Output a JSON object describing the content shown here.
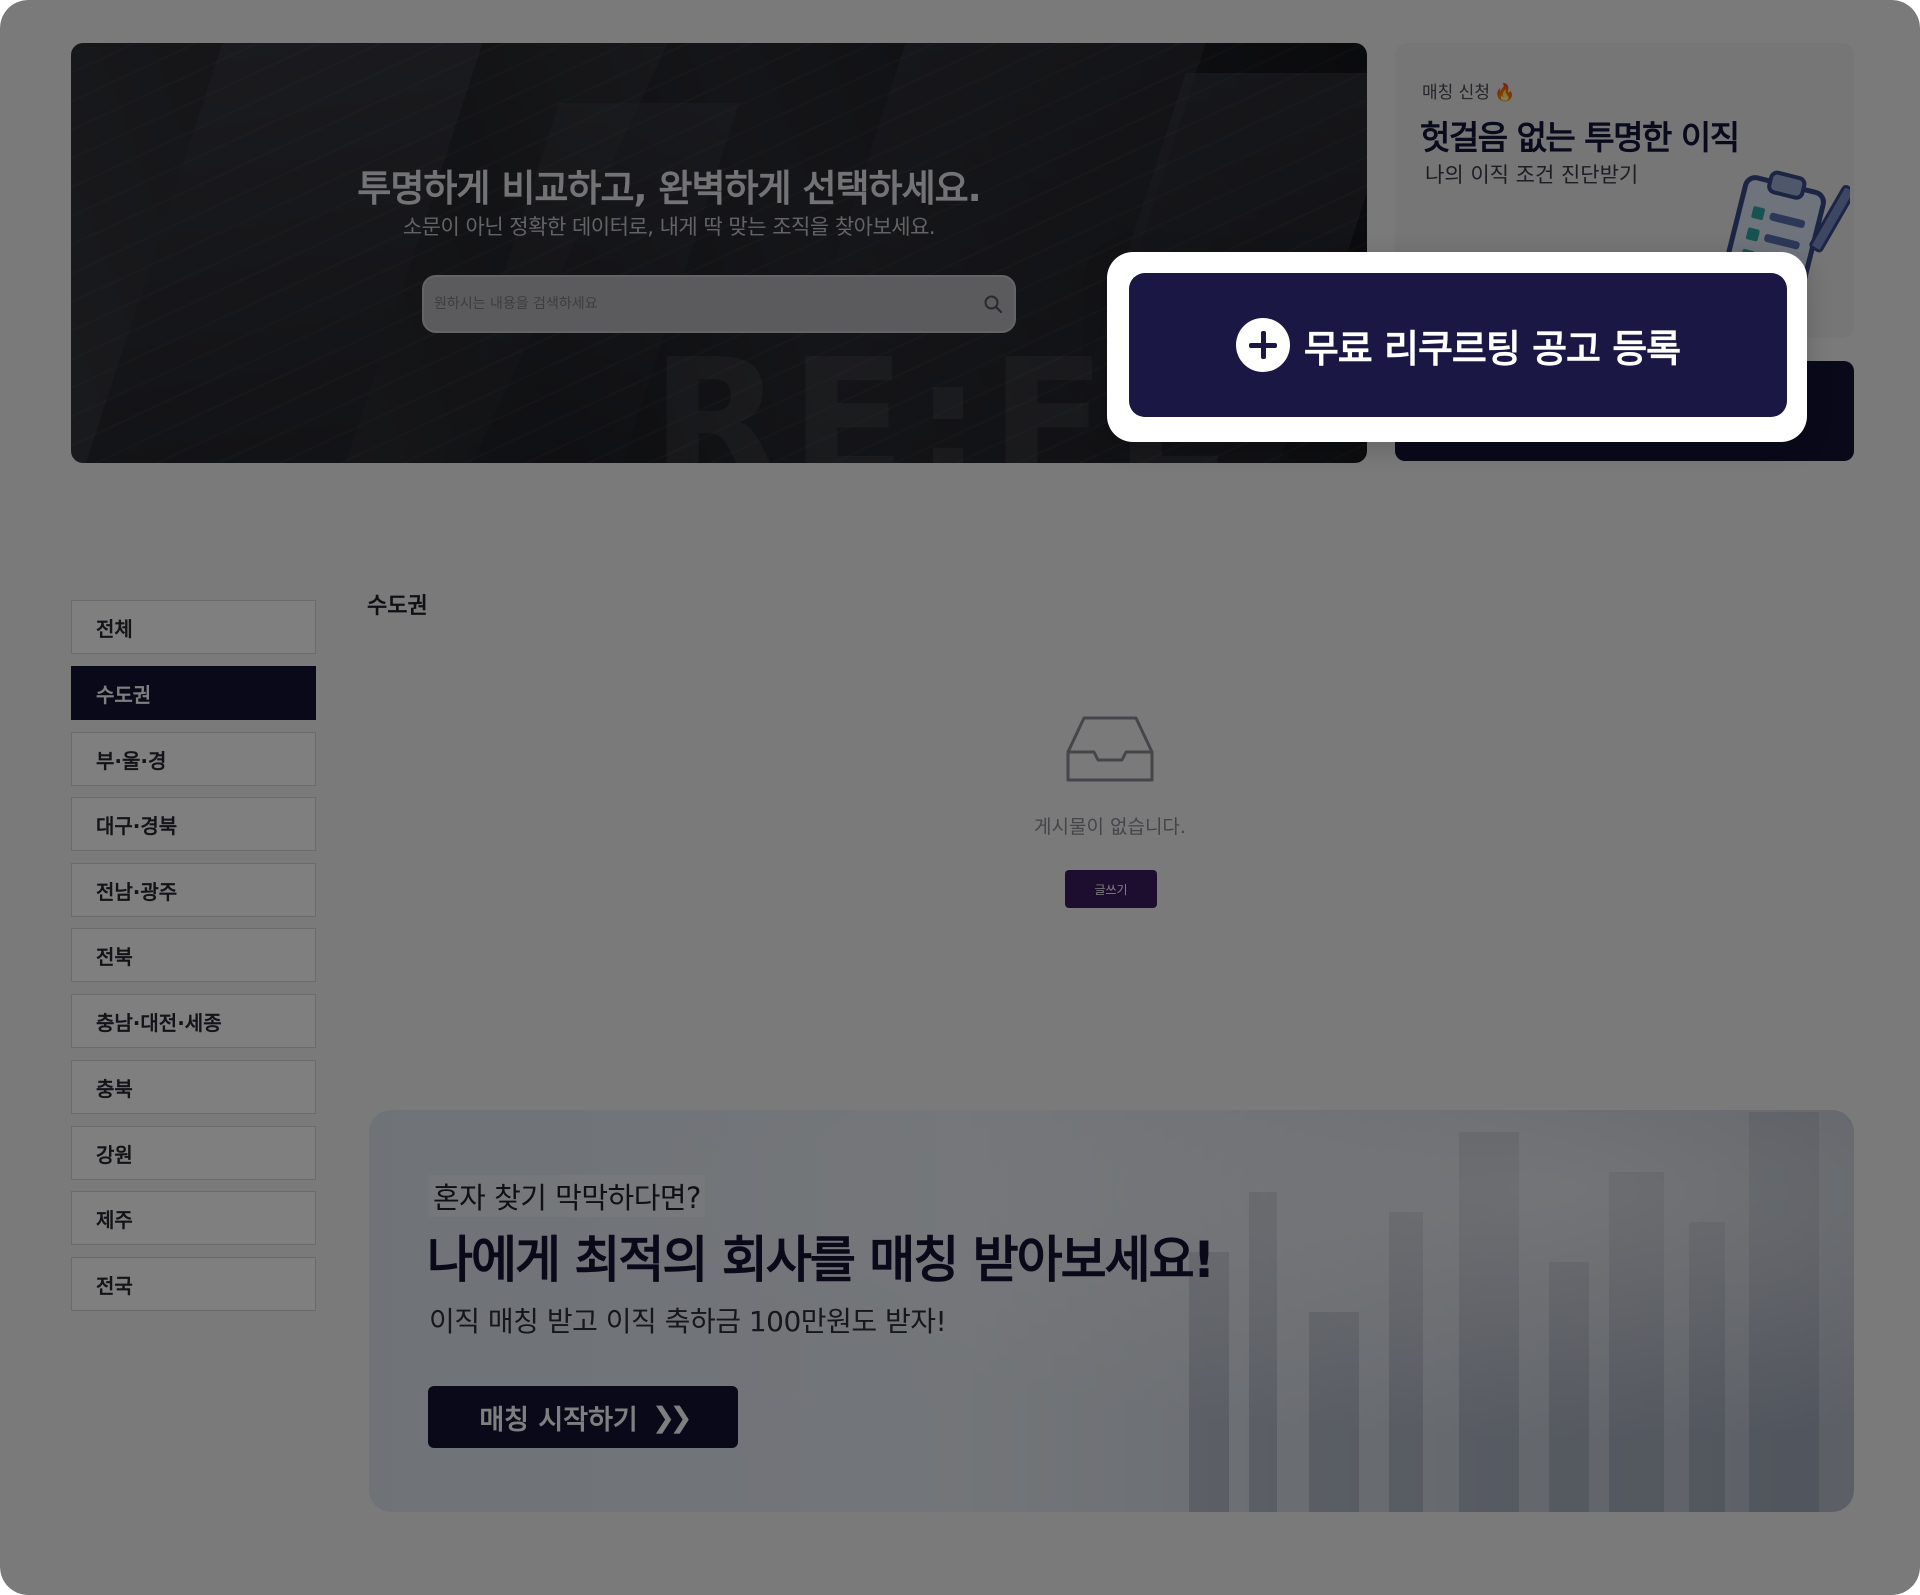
{
  "hero": {
    "title": "투명하게 비교하고, 완벽하게 선택하세요.",
    "subtitle": "소문이 아닌 정확한 데이터로, 내게 딱 맞는 조직을 찾아보세요.",
    "search_placeholder": "원하시는 내용을 검색하세요",
    "watermark": "RE:FE"
  },
  "match_card": {
    "tag": "매칭 신청",
    "title": "헛걸음 없는 투명한 이직",
    "description": "나의 이직 조건 진단받기"
  },
  "recruit_button": {
    "label": "무료 리쿠르팅 공고 등록"
  },
  "sidebar": {
    "items": [
      {
        "label": "전체",
        "active": false
      },
      {
        "label": "수도권",
        "active": true
      },
      {
        "label": "부·울·경",
        "active": false
      },
      {
        "label": "대구·경북",
        "active": false
      },
      {
        "label": "전남·광주",
        "active": false
      },
      {
        "label": "전북",
        "active": false
      },
      {
        "label": "충남·대전·세종",
        "active": false
      },
      {
        "label": "충북",
        "active": false
      },
      {
        "label": "강원",
        "active": false
      },
      {
        "label": "제주",
        "active": false
      },
      {
        "label": "전국",
        "active": false
      }
    ]
  },
  "main": {
    "section_title": "수도권",
    "empty_message": "게시물이 없습니다.",
    "write_button": "글쓰기"
  },
  "banner": {
    "lead": "혼자 찾기 막막하다면?",
    "headline": "나에게 최적의 회사를 매칭 받아보세요!",
    "subline": "이직 매칭 받고 이직 축하금 100만원도 받자!",
    "button_label": "매칭 시작하기"
  },
  "colors": {
    "navy": "#151235",
    "button_navy": "#1a1744",
    "write_button": "#3a1c5e",
    "overlay": "rgba(0,0,0,0.5)"
  }
}
